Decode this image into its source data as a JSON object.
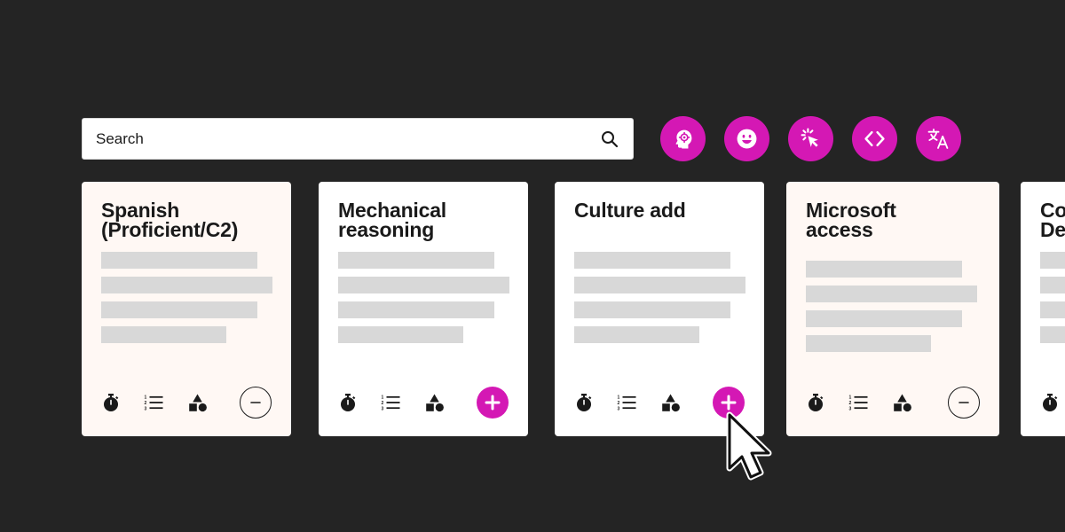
{
  "colors": {
    "background": "#242424",
    "accent": "#d418b4",
    "card_white": "#ffffff",
    "card_cream": "#fff8f4",
    "placeholder_line": "#d8d8d8",
    "text": "#1a1a1a"
  },
  "search": {
    "placeholder": "Search",
    "icon": "search-icon"
  },
  "filters": [
    {
      "name": "cognitive-ability",
      "icon": "head-gear-icon"
    },
    {
      "name": "personality",
      "icon": "smiley-face-icon"
    },
    {
      "name": "situational-judgement",
      "icon": "click-pointer-icon"
    },
    {
      "name": "programming-skills",
      "icon": "code-brackets-icon"
    },
    {
      "name": "language",
      "icon": "translate-icon"
    }
  ],
  "cards": [
    {
      "title": "Spanish (Proficient/C2)",
      "title_lines": [
        "Spanish",
        "(Proficient/C2)"
      ],
      "theme": "cream",
      "action": "remove",
      "footer_icons": [
        "stopwatch-icon",
        "numbered-list-icon",
        "shapes-icon"
      ]
    },
    {
      "title": "Mechanical reasoning",
      "title_lines": [
        "Mechanical",
        "reasoning"
      ],
      "theme": "white",
      "action": "add",
      "footer_icons": [
        "stopwatch-icon",
        "numbered-list-icon",
        "shapes-icon"
      ]
    },
    {
      "title": "Culture add",
      "title_lines": [
        "Culture add"
      ],
      "theme": "white",
      "action": "add",
      "footer_icons": [
        "stopwatch-icon",
        "numbered-list-icon",
        "shapes-icon"
      ]
    },
    {
      "title": "Microsoft access",
      "title_lines": [
        "Microsoft",
        "access"
      ],
      "theme": "cream",
      "action": "remove",
      "footer_icons": [
        "stopwatch-icon",
        "numbered-list-icon",
        "shapes-icon"
      ]
    },
    {
      "title": "Co De",
      "title_lines": [
        "Co",
        "De"
      ],
      "theme": "white",
      "action": "add",
      "footer_icons": [
        "stopwatch-icon"
      ],
      "partially_visible": true
    }
  ]
}
